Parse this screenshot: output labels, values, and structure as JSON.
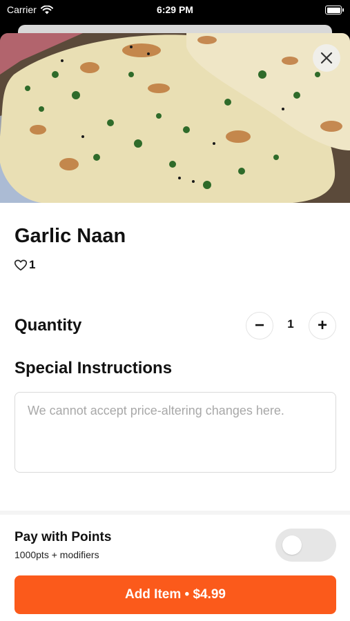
{
  "status_bar": {
    "carrier": "Carrier",
    "time": "6:29 PM",
    "icons": [
      "wifi-icon",
      "battery-icon"
    ]
  },
  "item": {
    "name": "Garlic Naan",
    "likes": "1",
    "image": "garlic-naan-photo"
  },
  "quantity": {
    "label": "Quantity",
    "value": "1",
    "decrement": "−",
    "increment": "+"
  },
  "special_instructions": {
    "label": "Special Instructions",
    "placeholder": "We cannot accept price-altering changes here.",
    "value": ""
  },
  "points": {
    "label": "Pay with Points",
    "subtitle": "1000pts + modifiers",
    "enabled": false
  },
  "add_button": {
    "label": "Add Item • $4.99"
  },
  "colors": {
    "accent": "#fb5a1b",
    "toggle_off": "#e6e6e6"
  }
}
